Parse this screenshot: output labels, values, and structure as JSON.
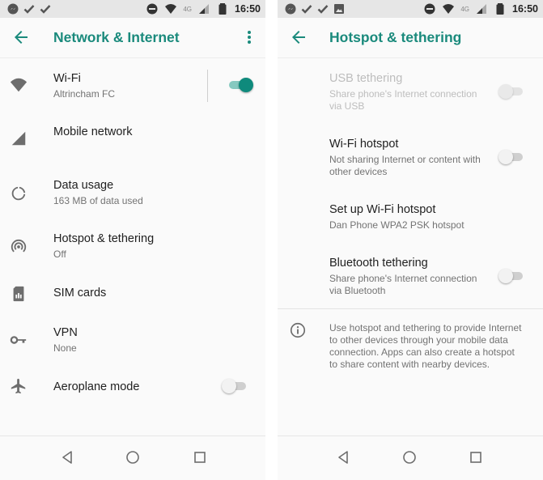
{
  "status_bar": {
    "time": "16:50",
    "network_label": "4G"
  },
  "left_screen": {
    "title": "Network & Internet",
    "back_icon": "arrow-back-icon",
    "more_icon": "more-vert-icon",
    "items": [
      {
        "title": "Wi-Fi",
        "subtitle": "Altrincham FC",
        "icon": "wifi-icon",
        "toggle": "on"
      },
      {
        "title": "Mobile network",
        "subtitle": "",
        "icon": "signal-icon"
      },
      {
        "title": "Data usage",
        "subtitle": "163 MB of data used",
        "icon": "data-usage-icon"
      },
      {
        "title": "Hotspot & tethering",
        "subtitle": "Off",
        "icon": "hotspot-icon"
      },
      {
        "title": "SIM cards",
        "subtitle": "",
        "icon": "sim-card-icon"
      },
      {
        "title": "VPN",
        "subtitle": "None",
        "icon": "vpn-key-icon"
      },
      {
        "title": "Aeroplane mode",
        "subtitle": "",
        "icon": "airplane-icon",
        "toggle": "off"
      }
    ]
  },
  "right_screen": {
    "title": "Hotspot & tethering",
    "back_icon": "arrow-back-icon",
    "items": [
      {
        "title": "USB tethering",
        "subtitle": "Share phone's Internet connection via USB",
        "toggle": "off",
        "disabled": true
      },
      {
        "title": "Wi-Fi hotspot",
        "subtitle": "Not sharing Internet or content with other devices",
        "toggle": "off"
      },
      {
        "title": "Set up Wi-Fi hotspot",
        "subtitle": "Dan Phone WPA2 PSK hotspot"
      },
      {
        "title": "Bluetooth tethering",
        "subtitle": "Share phone's Internet connection via Bluetooth",
        "toggle": "off"
      }
    ],
    "info_icon": "info-icon",
    "info_text": "Use hotspot and tethering to provide Internet to other devices through your mobile data connection. Apps can also create a hotspot to share content with nearby devices."
  },
  "nav_bar": {
    "back_icon": "nav-back-icon",
    "home_icon": "nav-home-icon",
    "recents_icon": "nav-recents-icon"
  },
  "colors": {
    "accent": "#1a8a7c",
    "toggle_on": "#0f8a7c",
    "status_bar_bg": "#e6e6e6",
    "background": "#fafafa"
  }
}
